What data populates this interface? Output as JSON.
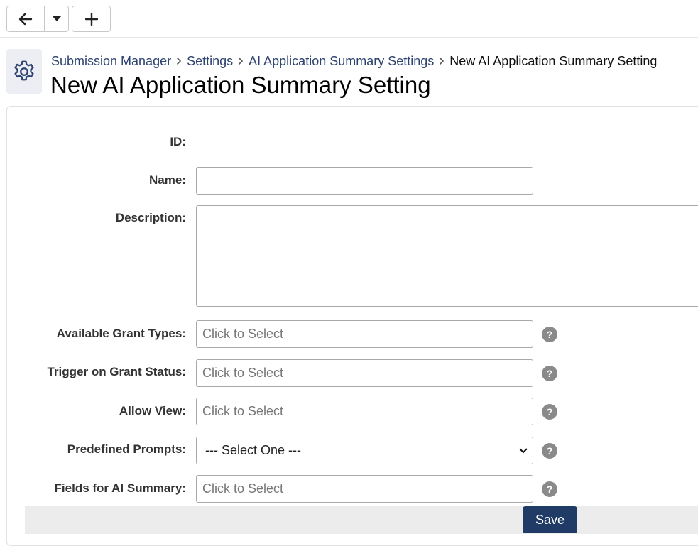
{
  "toolbar": {
    "back_icon": "arrow-left-icon",
    "dropdown_icon": "caret-down-icon",
    "add_icon": "plus-icon"
  },
  "header": {
    "icon": "gear-icon",
    "breadcrumb": [
      {
        "label": "Submission Manager"
      },
      {
        "label": "Settings"
      },
      {
        "label": "AI Application Summary Settings"
      }
    ],
    "breadcrumb_current": "New AI Application Summary Setting",
    "title": "New AI Application Summary Setting"
  },
  "form": {
    "id_label": "ID:",
    "name_label": "Name:",
    "name_value": "",
    "description_label": "Description:",
    "description_value": "",
    "grant_types_label": "Available Grant Types:",
    "grant_types_placeholder": "Click to Select",
    "grant_status_label": "Trigger on Grant Status:",
    "grant_status_placeholder": "Click to Select",
    "allow_view_label": "Allow View:",
    "allow_view_placeholder": "Click to Select",
    "prompts_label": "Predefined Prompts:",
    "prompts_selected": "--- Select One ---",
    "fields_label": "Fields for AI Summary:",
    "fields_placeholder": "Click to Select",
    "help_glyph": "?"
  },
  "actions": {
    "save_label": "Save"
  },
  "colors": {
    "primary": "#1f3b66",
    "link": "#2d4370"
  }
}
